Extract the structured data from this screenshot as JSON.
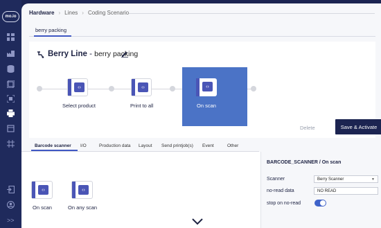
{
  "sidebar": {
    "logo": "mo.io",
    "icons": [
      "dashboard-icon",
      "factory-icon",
      "database-icon",
      "layers-icon",
      "scan-icon",
      "printer-icon",
      "frame-icon",
      "grid-icon",
      "login-icon",
      "user-icon"
    ],
    "expand": ">>"
  },
  "breadcrumb": {
    "items": [
      "Hardware",
      "Lines",
      "Coding Scenario"
    ],
    "sep": "›"
  },
  "top_tab": {
    "label": "berry packing"
  },
  "header": {
    "line_name": "Berry Line",
    "dash": " - ",
    "scenario": "berry packing"
  },
  "flow": {
    "nodes": [
      "Select product",
      "Print to all",
      "On scan"
    ],
    "selected": "On scan"
  },
  "actions": {
    "delete": "Delete",
    "save": "Save & Activate"
  },
  "tabs": [
    "Barcode scanner",
    "I/O",
    "Production data",
    "Layout",
    "Send printjob(s)",
    "Event",
    "Other"
  ],
  "active_tab": "Barcode scanner",
  "triggers": [
    "On scan",
    "On any scan"
  ],
  "panel": {
    "title": "BARCODE_SCANNER / On scan",
    "scanner_label": "Scanner",
    "scanner_value": "Berry Scanner",
    "noread_label": "no-read data",
    "noread_value": "NO READ",
    "stop_label": "stop on no-read",
    "stop_on_noread": true
  },
  "colors": {
    "accent": "#4b73c6",
    "nav": "#1c2451",
    "node": "#4a55b6"
  }
}
